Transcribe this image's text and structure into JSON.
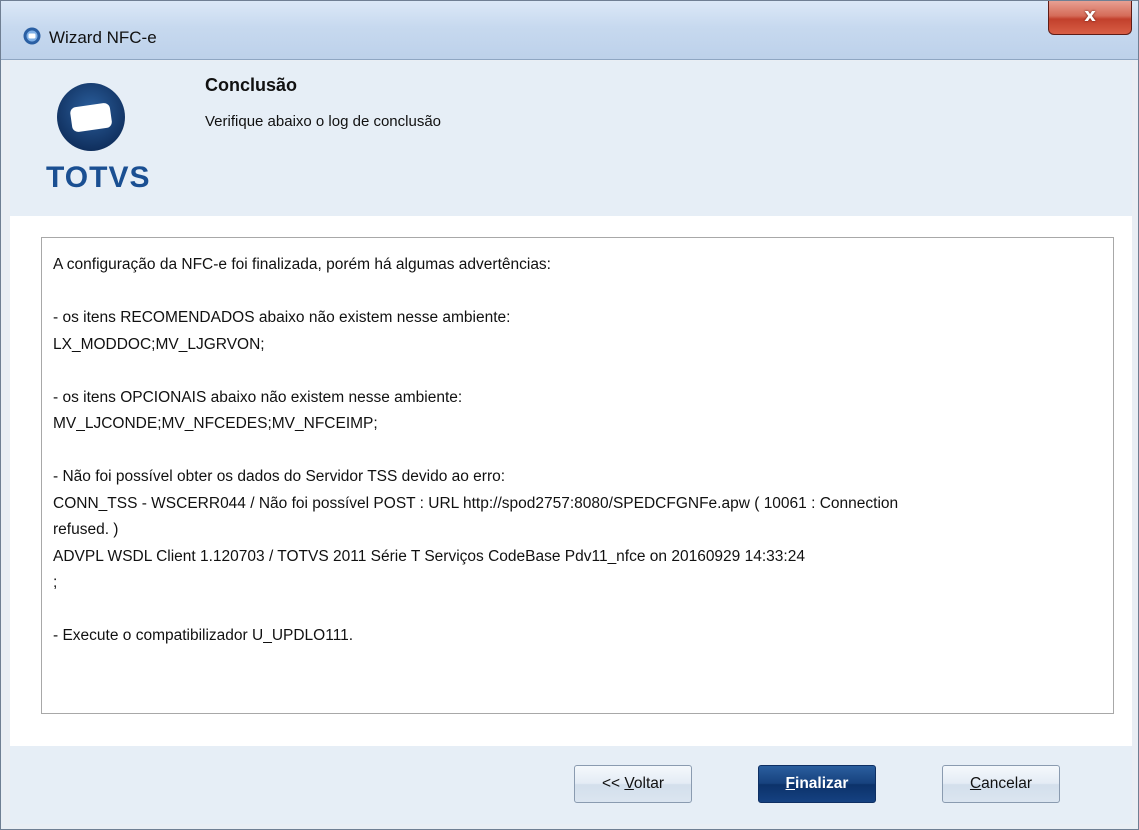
{
  "window": {
    "title": "Wizard NFC-e",
    "close_label": "x"
  },
  "header": {
    "logo_text": "TOTVS",
    "title": "Conclusão",
    "subtitle": "Verifique abaixo o log de conclusão"
  },
  "log": {
    "lines": [
      "A configuração da NFC-e foi finalizada, porém há algumas advertências:",
      "",
      "- os itens RECOMENDADOS abaixo não existem nesse ambiente:",
      "LX_MODDOC;MV_LJGRVON;",
      "",
      "- os itens OPCIONAIS abaixo não existem nesse ambiente:",
      "MV_LJCONDE;MV_NFCEDES;MV_NFCEIMP;",
      "",
      "- Não foi possível obter os dados do Servidor TSS devido ao erro:",
      "CONN_TSS - WSCERR044 / Não foi possível POST : URL http://spod2757:8080/SPEDCFGNFe.apw ( 10061 : Connection",
      "refused. )",
      "ADVPL WSDL Client 1.120703 / TOTVS 2011 Série T Serviços CodeBase Pdv11_nfce on 20160929 14:33:24",
      ";",
      "",
      "- Execute o compatibilizador U_UPDLO111."
    ]
  },
  "footer": {
    "back_label_prefix": "<< ",
    "back_label_accel": "V",
    "back_label_rest": "oltar",
    "finish_label_accel": "F",
    "finish_label_rest": "inalizar",
    "cancel_label_accel": "C",
    "cancel_label_rest": "ancelar"
  },
  "colors": {
    "brand": "#1a4f92",
    "finish_button": "#17427e",
    "close_button": "#c2402c"
  }
}
